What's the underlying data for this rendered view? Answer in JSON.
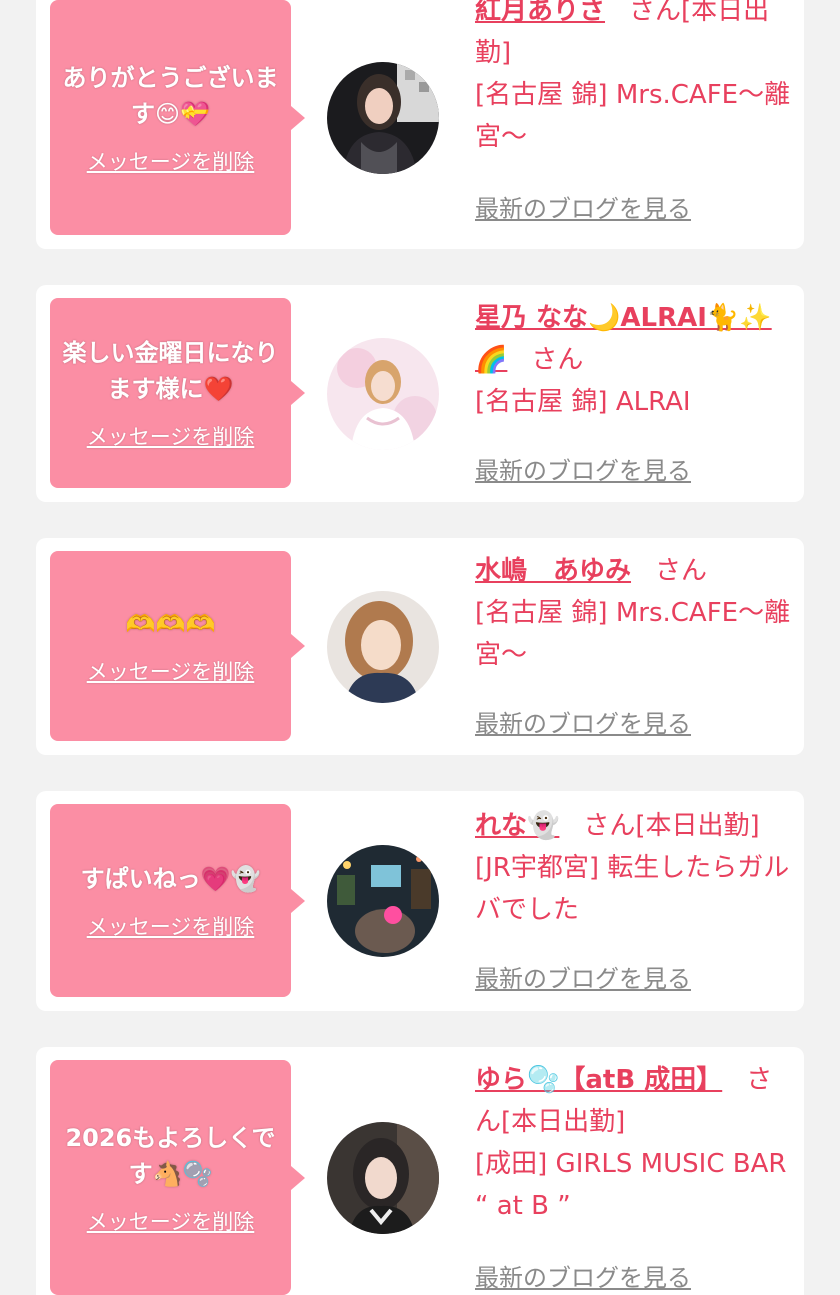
{
  "messages": [
    {
      "text": "ありがとうございます😊💝",
      "delete_label": "メッセージを削除",
      "name": "紅月ありさ",
      "honorific": "さん",
      "status": "[本日出勤]",
      "shop": "[名古屋 錦] Mrs.CAFE〜離宮〜",
      "blog_label": "最新のブログを見る"
    },
    {
      "text": "楽しい金曜日になります様に❤️",
      "delete_label": "メッセージを削除",
      "name": "星乃 なな🌙ALRAI🐈✨🌈",
      "honorific": "さん",
      "status": "",
      "shop": "[名古屋 錦] ALRAI",
      "blog_label": "最新のブログを見る"
    },
    {
      "text": "🫶🫶🫶",
      "delete_label": "メッセージを削除",
      "name": "水嶋　あゆみ",
      "honorific": "さん",
      "status": "",
      "shop": "[名古屋 錦] Mrs.CAFE〜離宮〜",
      "blog_label": "最新のブログを見る"
    },
    {
      "text": "すぱいねっ💗👻",
      "delete_label": "メッセージを削除",
      "name": "れな👻",
      "honorific": "さん",
      "status": "[本日出勤]",
      "shop": "[JR宇都宮] 転生したらガルバでした",
      "blog_label": "最新のブログを見る"
    },
    {
      "text": "2026もよろしくです🐴🫧",
      "delete_label": "メッセージを削除",
      "name": "ゆら🫧【atB 成田】",
      "honorific": "さん",
      "status": "[本日出勤]",
      "shop": "[成田] GIRLS MUSIC BAR “ at B ”",
      "blog_label": "最新のブログを見る"
    }
  ],
  "colors": {
    "page_bg": "#f2f2f2",
    "bubble": "#fb8ea4",
    "accent": "#e8405e",
    "link_gray": "#8a8a8a"
  }
}
